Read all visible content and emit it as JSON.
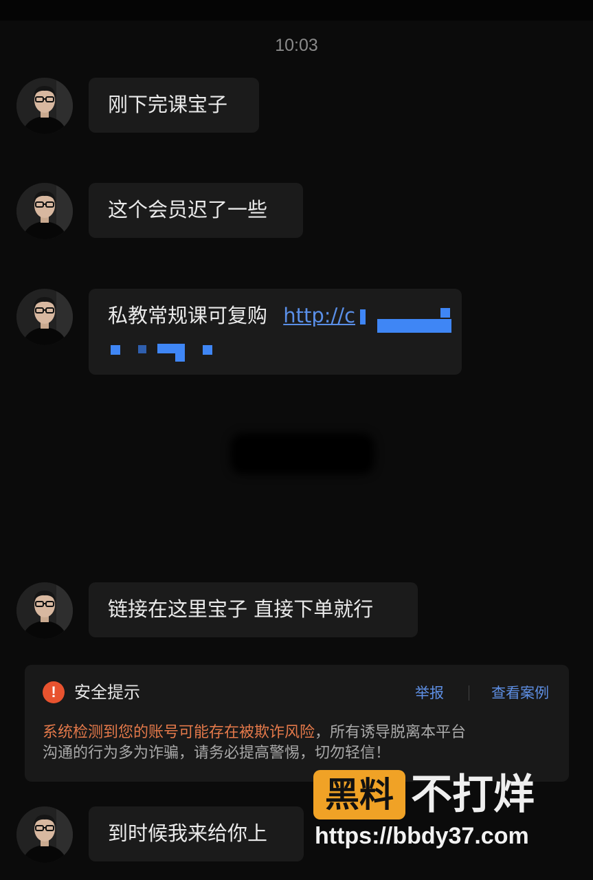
{
  "chat": {
    "timestamp": "10:03",
    "messages": [
      {
        "text": "刚下完课宝子"
      },
      {
        "text": "这个会员迟了一些"
      },
      {
        "text": "私教常规课可复购",
        "link": "http://c"
      },
      {
        "text": "链接在这里宝子 直接下单就行"
      },
      {
        "text": "到时候我来给你上"
      }
    ]
  },
  "security_notice": {
    "icon": "exclamation-icon",
    "icon_glyph": "!",
    "title": "安全提示",
    "report_label": "举报",
    "view_cases_label": "查看案例",
    "risk_text": "系统检测到您的账号可能存在被欺诈风险",
    "body_rest_line1": "，所有诱导脱离本平台",
    "body_rest_line2": "沟通的行为多为诈骗，请务必提高警惕，切勿轻信！"
  },
  "watermark": {
    "logo_text": "黑料",
    "name": "不打烊",
    "url": "https://bbdy37.com"
  },
  "colors": {
    "background": "#0b0b0b",
    "bubble": "#1b1b1b",
    "link": "#5a8fe8",
    "warning": "#e8532f",
    "risk_text": "#e4794a",
    "watermark_logo_bg": "#f0a226"
  }
}
